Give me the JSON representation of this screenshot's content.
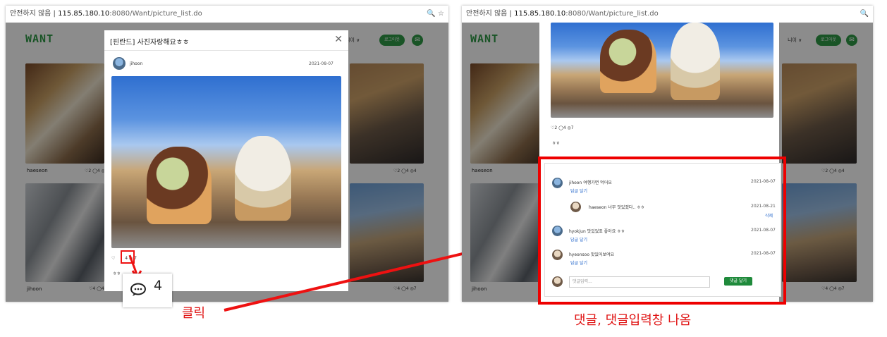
{
  "left": {
    "url_prefix": "안전하지 않음  |  ",
    "url_host": "115.85.180.10",
    "url_rest": ":8080/Want/picture_list.do",
    "logo": "WANT",
    "nav_menu": "니이 ∨",
    "nav_btn": "로그아웃",
    "cards": [
      {
        "user": "haeseon",
        "stats": "♡2 ◯4 ◎4"
      },
      {
        "user": "jihoon",
        "stats": "♡4 ◯4 ◎7"
      }
    ],
    "modal": {
      "title": "[핀란드] 사진자랑해요ㅎㅎ",
      "close": "✕",
      "user": "jihoon",
      "date": "2021-08-07",
      "stats_like": "♡",
      "stats_rest": "4 ◎ 7",
      "caption": "ㅎㅎ"
    },
    "zoom_count": "4",
    "click_label": "클릭"
  },
  "right": {
    "url_prefix": "안전하지 않음  |  ",
    "url_host": "115.85.180.10",
    "url_rest": ":8080/Want/picture_list.do",
    "logo": "WANT",
    "nav_menu": "니이 ∨",
    "nav_btn": "로그아웃",
    "cards": [
      {
        "user": "haeseon",
        "stats": "♡2 ◯4 ◎4"
      },
      {
        "user": "jihoon",
        "stats": "♡4 ◯4 ◎7"
      }
    ],
    "modal": {
      "stats": "♡2 ◯4 ◎7",
      "caption": "ㅎㅎ"
    },
    "comments": [
      {
        "user": "jihoon",
        "text": "jihoon 여행가면 먹어요",
        "date": "2021-08-07",
        "action": "답글 달기"
      },
      {
        "user": "haeseon",
        "text": "haeseon 너무 맛있겠다.. ㅎㅎ",
        "date": "2021-08-21",
        "action": "삭제"
      },
      {
        "user": "hyokjun",
        "text": "hyokjun 맛있었죠 좋아요 ㅎㅎ",
        "date": "2021-08-07",
        "action": "답글 달기"
      },
      {
        "user": "hyeonsoo",
        "text": "hyeonsoo 맛있어보여요",
        "date": "2021-08-07",
        "action": "답글 달기"
      }
    ],
    "input_placeholder": "댓글입력...",
    "submit_label": "댓글 달기",
    "caption_label": "댓글, 댓글입력창 나옴"
  },
  "colors": {
    "brand_green": "#2e9a46",
    "annotation_red": "#ee1111",
    "heart": "#e04848"
  }
}
